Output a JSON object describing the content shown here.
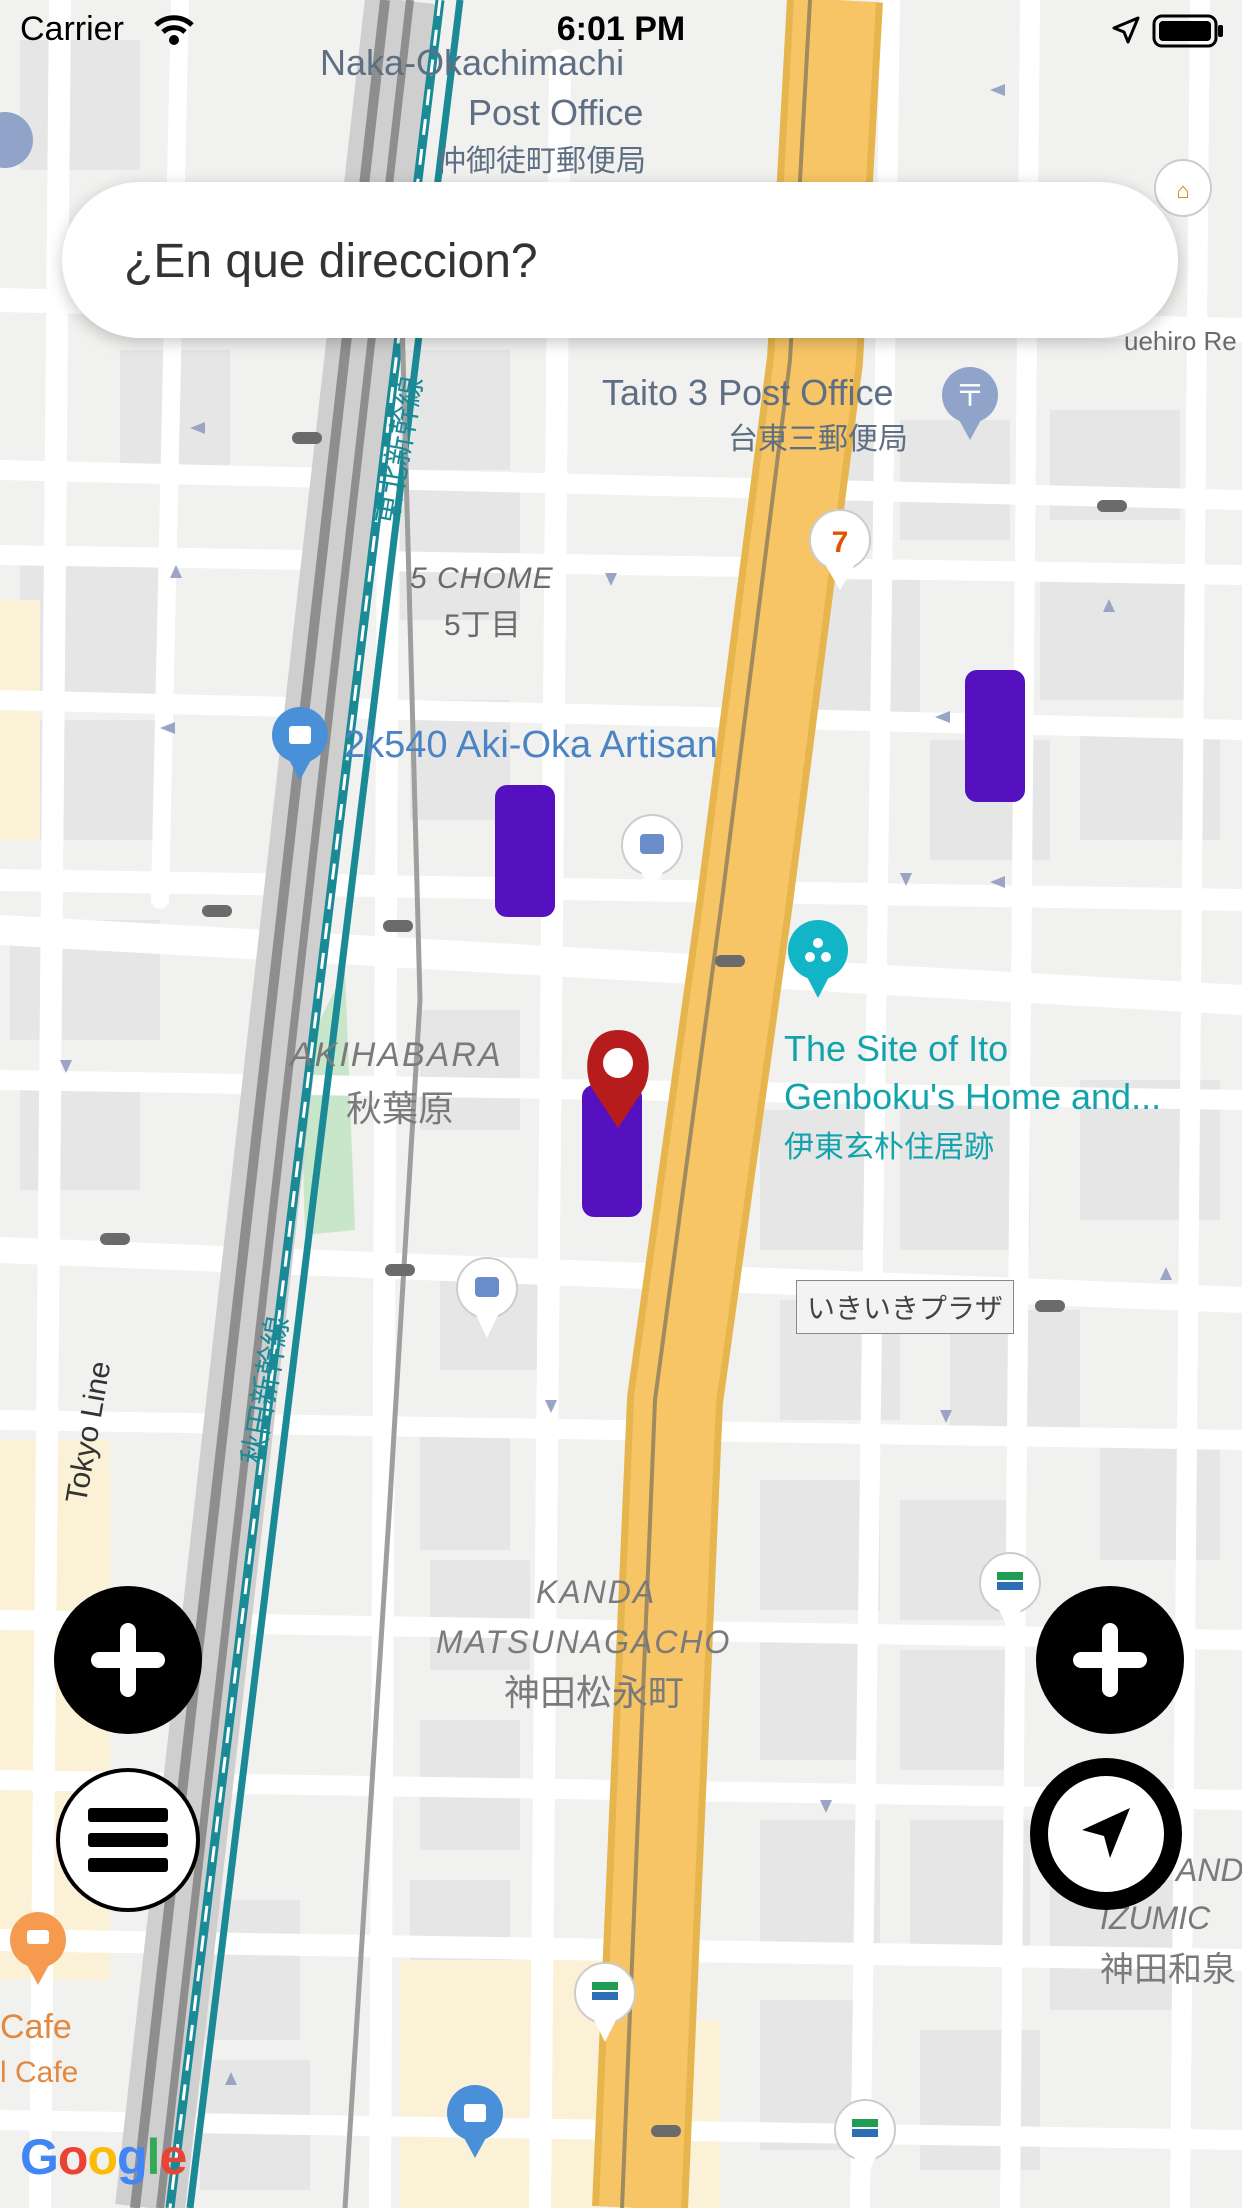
{
  "status_bar": {
    "carrier": "Carrier",
    "time": "6:01 PM"
  },
  "search": {
    "placeholder": "¿En que direccion?"
  },
  "map": {
    "labels": {
      "naka_post_1": "Naka-Okachimachi",
      "naka_post_2": "Post Office",
      "naka_post_jp": "仲御徒町郵便局",
      "taito_post": "Taito 3 Post Office",
      "taito_post_jp": "台東三郵便局",
      "chome": "5 CHOME",
      "chome_jp": "5丁目",
      "aki_oka": "2k540 Aki-Oka Artisan",
      "akihabara": "AKIHABARA",
      "akihabara_jp": "秋葉原",
      "ito_1": "The Site of Ito",
      "ito_2": "Genboku's Home and...",
      "ito_jp": "伊東玄朴住居跡",
      "plaza": "いきいきプラザ",
      "kanda_1": "KANDA",
      "kanda_2": "MATSUNAGACHO",
      "kanda_jp": "神田松永町",
      "tokyo_line": "Tokyo Line",
      "akita_shinkansen": "秋田新幹線",
      "tohoku_shinkansen": "東北新幹線",
      "uehiro": "uehiro Re",
      "izumi_1": "AND",
      "izumi_2": "IZUMIC",
      "izumi_jp": "神田和泉",
      "cafe_1": "Cafe",
      "cafe_2": "l Cafe"
    },
    "colors": {
      "land": "#f1f1ef",
      "block": "#e6e6e6",
      "road": "#ffffff",
      "highway": "#f8c566",
      "rail": "#1b8a97",
      "marker": "#5510c0",
      "pin": "#b71c1c"
    },
    "pin_icon": "location-pin-icon",
    "markers_count": 3
  },
  "controls": {
    "add_left_icon": "plus-icon",
    "add_right_icon": "plus-icon",
    "menu_icon": "hamburger-menu-icon",
    "locate_icon": "navigation-arrow-icon"
  },
  "attribution": {
    "logo": "Google"
  }
}
